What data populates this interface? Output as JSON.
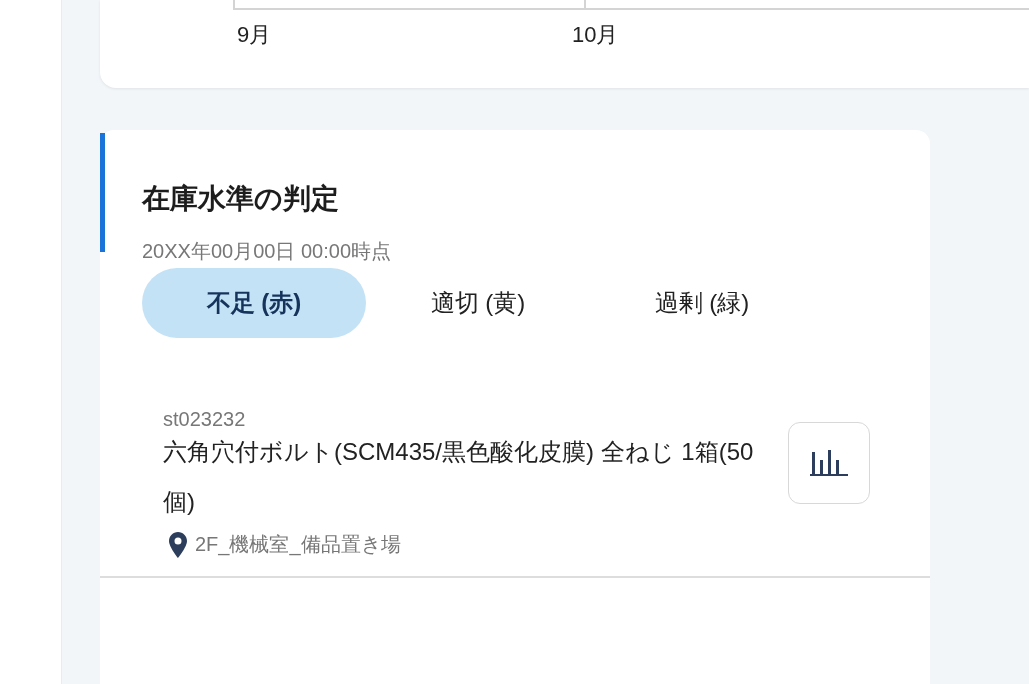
{
  "chart_card": {
    "x_labels": [
      "9月",
      "10月"
    ]
  },
  "stock_card": {
    "title": "在庫水準の判定",
    "subtitle": "20XX年00月00日 00:00時点",
    "tabs": [
      {
        "label": "不足 (赤)",
        "selected": true
      },
      {
        "label": "適切 (黄)",
        "selected": false
      },
      {
        "label": "過剰 (緑)",
        "selected": false
      }
    ],
    "items": [
      {
        "code": "st023232",
        "name": "六角穴付ボルト(SCM435/黒色酸化皮膜) 全ねじ 1箱(50個)",
        "location": "2F_機械室_備品置き場"
      }
    ]
  }
}
